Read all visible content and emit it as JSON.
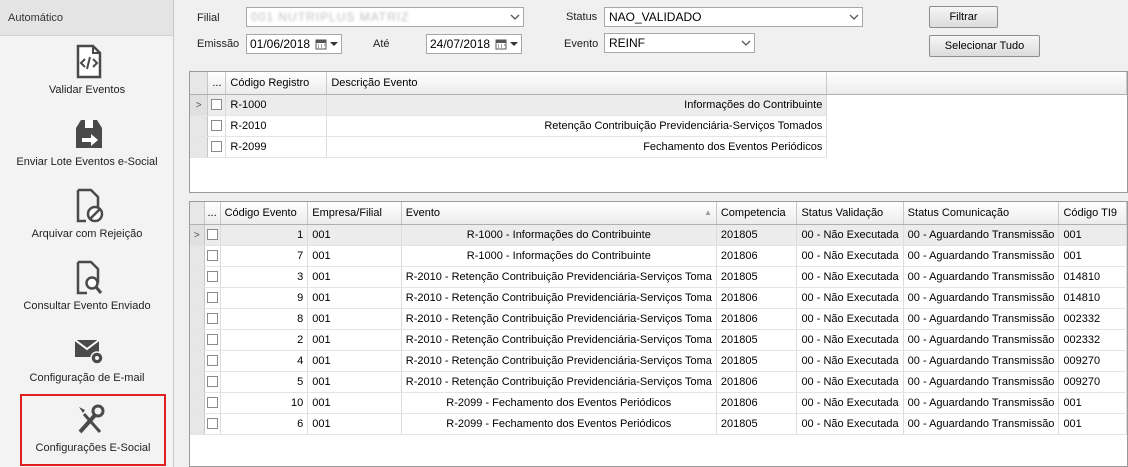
{
  "sidebar": {
    "header": "Automático",
    "items": [
      {
        "label": "Validar Eventos",
        "icon": "code-document-icon"
      },
      {
        "label": "Enviar Lote Eventos e-Social",
        "icon": "send-box-icon"
      },
      {
        "label": "Arquivar com Rejeição",
        "icon": "document-block-icon"
      },
      {
        "label": "Consultar Evento Enviado",
        "icon": "document-search-icon"
      },
      {
        "label": "Configuração de E-mail",
        "icon": "email-gear-icon"
      },
      {
        "label": "Configurações E-Social",
        "icon": "tools-icon"
      }
    ]
  },
  "filters": {
    "filial_label": "Filial",
    "filial_value": "001 NUTRIPLUS MATRIZ",
    "status_label": "Status",
    "status_value": "NAO_VALIDADO",
    "emissao_label": "Emissão",
    "emissao_value": "01/06/2018",
    "ate_label": "Até",
    "ate_value": "24/07/2018",
    "evento_label": "Evento",
    "evento_value": "REINF",
    "filtrar_label": "Filtrar",
    "selecionar_label": "Selecionar Tudo"
  },
  "registros": {
    "columns": [
      "...",
      "Código Registro",
      "Descrição Evento"
    ],
    "rows": [
      {
        "codigo": "R-1000",
        "descricao": "Informações do Contribuinte"
      },
      {
        "codigo": "R-2010",
        "descricao": "Retenção Contribuição Previdenciária-Serviços Tomados"
      },
      {
        "codigo": "R-2099",
        "descricao": "Fechamento dos Eventos Periódicos"
      }
    ]
  },
  "eventos": {
    "columns": [
      "...",
      "Código Evento",
      "Empresa/Filial",
      "Evento",
      "Competencia",
      "Status Validação",
      "Status Comunicação",
      "Código TI9"
    ],
    "rows": [
      {
        "codigo": "1",
        "empresa": "001",
        "evento": "R-1000 - Informações do Contribuinte",
        "competencia": "201805",
        "status_validacao": "00 - Não Executada",
        "status_comunicacao": "00 - Aguardando Transmissão",
        "ti9": "001"
      },
      {
        "codigo": "7",
        "empresa": "001",
        "evento": "R-1000 - Informações do Contribuinte",
        "competencia": "201806",
        "status_validacao": "00 - Não Executada",
        "status_comunicacao": "00 - Aguardando Transmissão",
        "ti9": "001"
      },
      {
        "codigo": "3",
        "empresa": "001",
        "evento": "R-2010 - Retenção Contribuição Previdenciária-Serviços Toma",
        "competencia": "201805",
        "status_validacao": "00 - Não Executada",
        "status_comunicacao": "00 - Aguardando Transmissão",
        "ti9": "014810"
      },
      {
        "codigo": "9",
        "empresa": "001",
        "evento": "R-2010 - Retenção Contribuição Previdenciária-Serviços Toma",
        "competencia": "201806",
        "status_validacao": "00 - Não Executada",
        "status_comunicacao": "00 - Aguardando Transmissão",
        "ti9": "014810"
      },
      {
        "codigo": "8",
        "empresa": "001",
        "evento": "R-2010 - Retenção Contribuição Previdenciária-Serviços Toma",
        "competencia": "201806",
        "status_validacao": "00 - Não Executada",
        "status_comunicacao": "00 - Aguardando Transmissão",
        "ti9": "002332"
      },
      {
        "codigo": "2",
        "empresa": "001",
        "evento": "R-2010 - Retenção Contribuição Previdenciária-Serviços Toma",
        "competencia": "201805",
        "status_validacao": "00 - Não Executada",
        "status_comunicacao": "00 - Aguardando Transmissão",
        "ti9": "002332"
      },
      {
        "codigo": "4",
        "empresa": "001",
        "evento": "R-2010 - Retenção Contribuição Previdenciária-Serviços Toma",
        "competencia": "201805",
        "status_validacao": "00 - Não Executada",
        "status_comunicacao": "00 - Aguardando Transmissão",
        "ti9": "009270"
      },
      {
        "codigo": "5",
        "empresa": "001",
        "evento": "R-2010 - Retenção Contribuição Previdenciária-Serviços Toma",
        "competencia": "201806",
        "status_validacao": "00 - Não Executada",
        "status_comunicacao": "00 - Aguardando Transmissão",
        "ti9": "009270"
      },
      {
        "codigo": "10",
        "empresa": "001",
        "evento": "R-2099 - Fechamento dos Eventos Periódicos",
        "competencia": "201806",
        "status_validacao": "00 - Não Executada",
        "status_comunicacao": "00 - Aguardando Transmissão",
        "ti9": "001"
      },
      {
        "codigo": "6",
        "empresa": "001",
        "evento": "R-2099 - Fechamento dos Eventos Periódicos",
        "competencia": "201805",
        "status_validacao": "00 - Não Executada",
        "status_comunicacao": "00 - Aguardando Transmissão",
        "ti9": "001"
      }
    ]
  },
  "colors": {
    "selected_outline": "#e02020",
    "current_row": "#ececec"
  }
}
